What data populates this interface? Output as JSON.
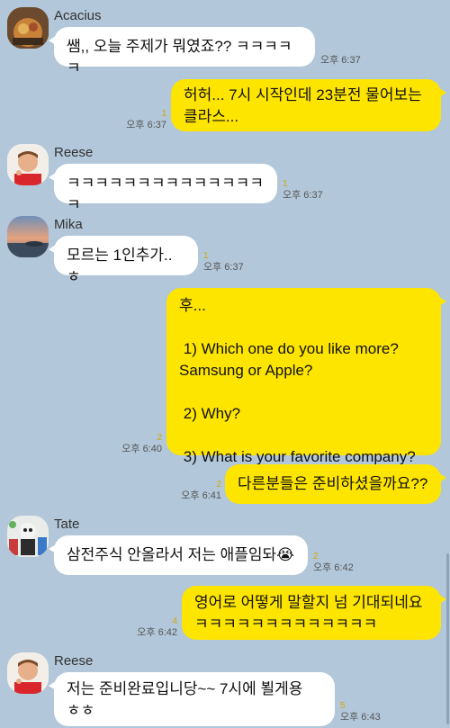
{
  "messages": [
    {
      "sender": "Acacius",
      "text": "쌤,, 오늘 주제가 뭐였죠?? ㅋㅋㅋㅋㅋ",
      "time": "오후 6:37",
      "unread": ""
    },
    {
      "text": "허허... 7시 시작인데 23분전 물어보는\n클라스...",
      "time": "오후 6:37",
      "unread": "1"
    },
    {
      "sender": "Reese",
      "text": "ㅋㅋㅋㅋㅋㅋㅋㅋㅋㅋㅋㅋㅋㅋㅋ",
      "time": "오후 6:37",
      "unread": "1"
    },
    {
      "sender": "Mika",
      "text": "모르는 1인추가..ㅎ",
      "time": "오후 6:37",
      "unread": "1"
    },
    {
      "text": "후...\n\n 1) Which one do you like more?\nSamsung or Apple?\n\n 2) Why?\n\n 3) What is your favorite company?",
      "time": "오후 6:40",
      "unread": "2"
    },
    {
      "text": "다른분들은 준비하셨을까요??",
      "time": "오후 6:41",
      "unread": "2"
    },
    {
      "sender": "Tate",
      "text": "삼전주식 안올라서 저는 애플임돠😭",
      "time": "오후 6:42",
      "unread": "2"
    },
    {
      "text": "영어로 어떻게 말할지 넘 기대되네요\nㅋㅋㅋㅋㅋㅋㅋㅋㅋㅋㅋㅋㅋ",
      "time": "오후 6:42",
      "unread": "4"
    },
    {
      "sender": "Reese",
      "text": "저는 준비완료입니당~~ 7시에 뵐게용\nㅎㅎ",
      "time": "오후 6:43",
      "unread": "5"
    }
  ],
  "colors": {
    "background": "#b2c7d9",
    "outgoing": "#fee500",
    "incoming": "#ffffff"
  }
}
